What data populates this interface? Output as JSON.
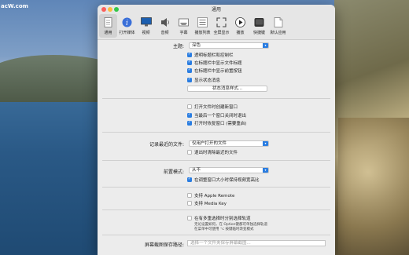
{
  "desktop": {
    "corner_text": "acW.com"
  },
  "window": {
    "title": "通用"
  },
  "toolbar": [
    {
      "label": "通用",
      "icon": "general-icon"
    },
    {
      "label": "打开媒体",
      "icon": "info-icon"
    },
    {
      "label": "视频",
      "icon": "monitor-icon"
    },
    {
      "label": "音频",
      "icon": "speaker-icon"
    },
    {
      "label": "字幕",
      "icon": "subtitles-icon"
    },
    {
      "label": "播放列表",
      "icon": "playlist-icon"
    },
    {
      "label": "全屏显示",
      "icon": "fullscreen-icon"
    },
    {
      "label": "播放",
      "icon": "play-icon"
    },
    {
      "label": "快捷键",
      "icon": "keyboard-icon"
    },
    {
      "label": "默认应用",
      "icon": "default-app-icon"
    }
  ],
  "theme": {
    "label": "主题:",
    "value": "深色",
    "options": [
      {
        "text": "透明标题栏和控制栏",
        "checked": true
      },
      {
        "text": "在标题栏中显示文件标题",
        "checked": true
      },
      {
        "text": "在标题栏中显示前置按钮",
        "checked": true
      },
      {
        "text": "显示状态消息",
        "checked": true
      }
    ],
    "status_button": "状态消息样式..."
  },
  "window_opts": [
    {
      "text": "打开文件时创建新窗口",
      "checked": false
    },
    {
      "text": "当最后一个窗口关闭时退出",
      "checked": true
    },
    {
      "text": "打开时恢复窗口 (需要重启)",
      "checked": true
    }
  ],
  "recent": {
    "label": "记录最近的文件:",
    "value": "仅用户打开的文件",
    "option": {
      "text": "退出时清除最近的文件",
      "checked": false
    }
  },
  "front": {
    "label": "前置模式:",
    "value": "从不",
    "option": {
      "text": "在调整窗口大小时保持视频宽高比",
      "checked": true
    }
  },
  "remote": [
    {
      "text": "支持 Apple Remote",
      "checked": false
    },
    {
      "text": "支持 Media Key",
      "checked": false
    }
  ],
  "multi": {
    "text": "在有多重选择时分别选择轨道",
    "checked": false,
    "note1": "无论设置如何，在 Option键都可单独选择轨道",
    "note2": "在菜单中可使用 ⌥ 按键临时改变模式"
  },
  "screenshot": {
    "label": "屏幕截图保存路径:",
    "placeholder": "选择一个文件夹保存屏幕截图..."
  }
}
